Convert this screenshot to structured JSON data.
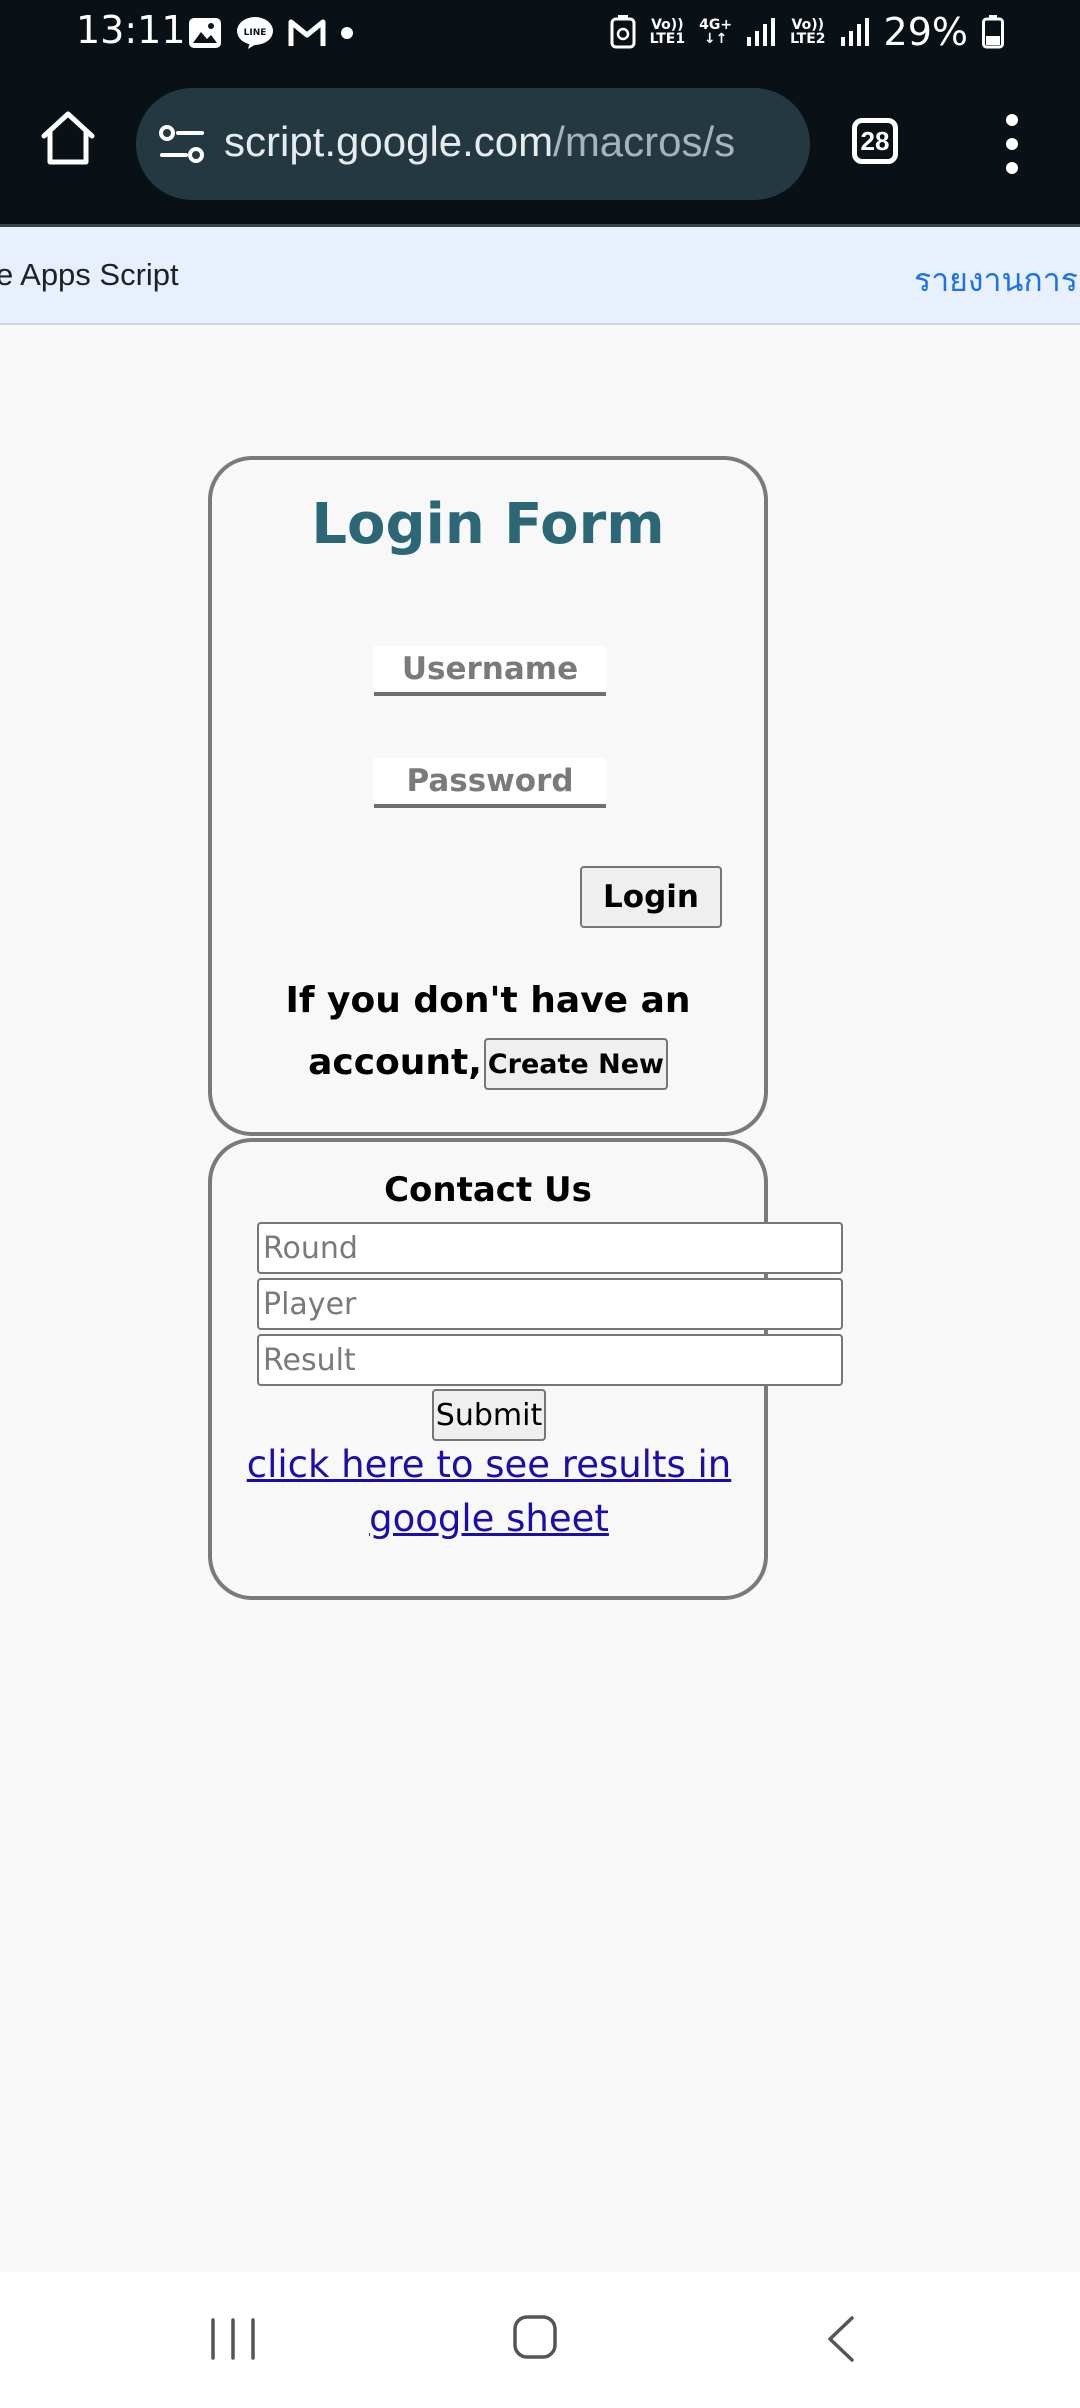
{
  "status_bar": {
    "time": "13:11",
    "left_icons": [
      "gallery-icon",
      "line-icon",
      "gmail-icon",
      "dot-icon"
    ],
    "lte1_top": "Vo))",
    "lte1_bottom": "LTE1",
    "net_type": "4G+",
    "lte2_top": "Vo))",
    "lte2_bottom": "LTE2",
    "battery": "29%"
  },
  "browser": {
    "url_main": "script.google.com",
    "url_path": "/macros/s",
    "tab_count": "28"
  },
  "banner": {
    "left_text": "e Apps Script",
    "right_text": "รายงานการล"
  },
  "login": {
    "title": "Login Form",
    "username_placeholder": "Username",
    "password_placeholder": "Password",
    "login_label": "Login",
    "account_text": "If you don't have an account,",
    "create_label": "Create New"
  },
  "contact": {
    "title": "Contact Us",
    "round_placeholder": "Round",
    "player_placeholder": "Player",
    "result_placeholder": "Result",
    "submit_label": "Submit",
    "link_text": "click here to see results in google sheet"
  },
  "colors": {
    "title_teal": "#2b6777",
    "link_blue": "#1a0dab",
    "chrome_dark": "#0a1116",
    "banner_bg": "#e8f0fe"
  }
}
